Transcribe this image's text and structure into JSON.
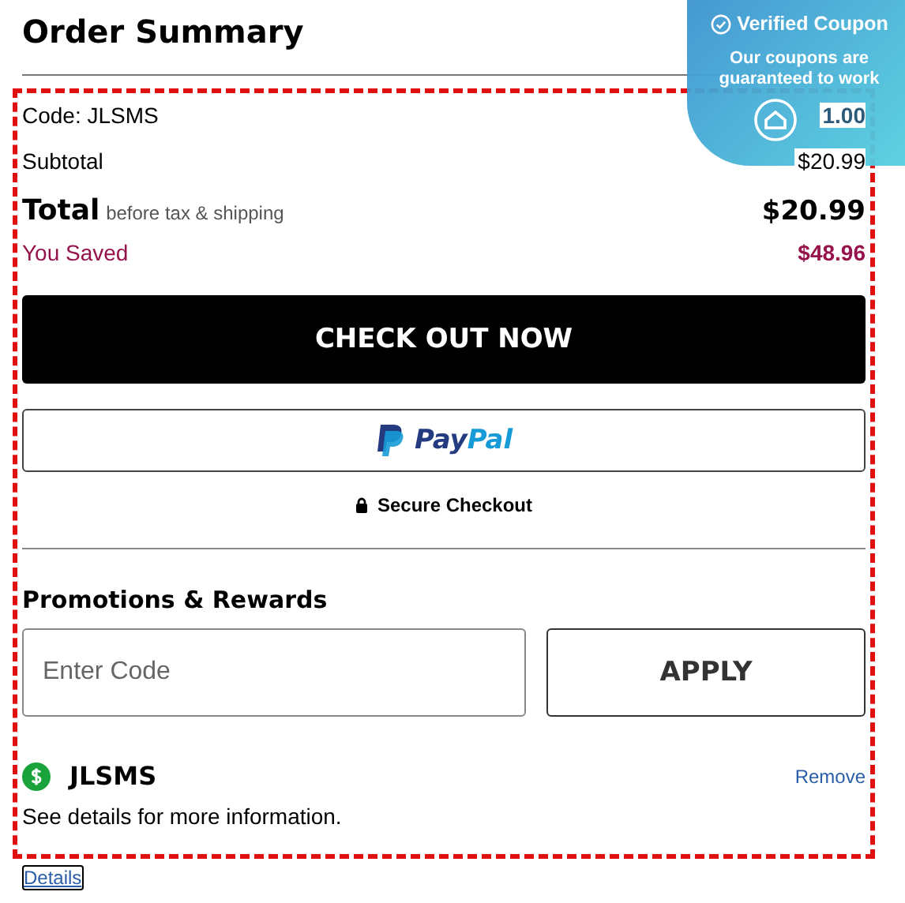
{
  "title": "Order Summary",
  "badge": {
    "title": "Verified Coupon",
    "text": "Our coupons are guaranteed to work"
  },
  "rows": [
    {
      "kind": "plain",
      "label": "Code: JLSMS",
      "value": "1.00"
    },
    {
      "kind": "plain",
      "label": "Subtotal",
      "value": "$20.99"
    },
    {
      "kind": "total",
      "label": "Total",
      "note": "before tax & shipping",
      "value": "$20.99"
    },
    {
      "kind": "saved",
      "label": "You Saved",
      "value": "$48.96"
    }
  ],
  "checkout_button": "CHECK OUT NOW",
  "paypal_button": {
    "pay": "Pay",
    "pal": "Pal"
  },
  "secure_note": "Secure Checkout",
  "promotions": {
    "heading": "Promotions & Rewards",
    "placeholder": "Enter Code",
    "apply_button": "APPLY"
  },
  "coupon": {
    "code": "JLSMS",
    "remove": "Remove",
    "note": "See details for more information."
  },
  "details_link": "Details"
}
